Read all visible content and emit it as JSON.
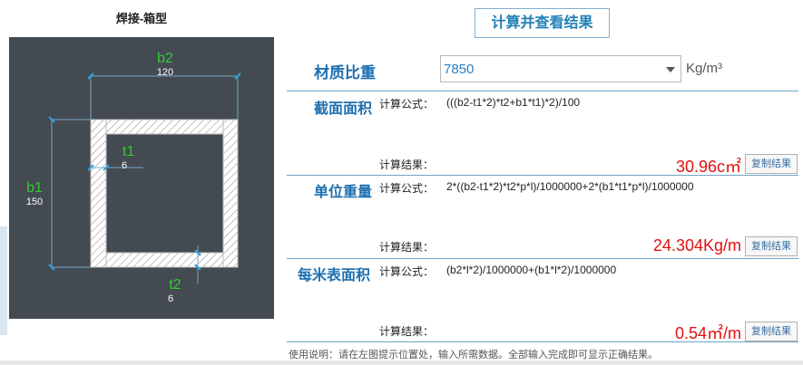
{
  "diagram": {
    "title": "焊接-箱型",
    "b2": {
      "label": "b2",
      "value": "120"
    },
    "b1": {
      "label": "b1",
      "value": "150"
    },
    "t1": {
      "label": "t1",
      "value": "6"
    },
    "t2": {
      "label": "t2",
      "value": "6"
    }
  },
  "calc_button": "计算并查看结果",
  "density": {
    "label": "材质比重",
    "value": "7850",
    "unit": "Kg/m³"
  },
  "sections": [
    {
      "title": "截面面积",
      "formula_label": "计算公式：",
      "formula": "(((b2-t1*2)*t2+b1*t1)*2)/100",
      "result_label": "计算结果：",
      "result": "30.96c㎡",
      "copy": "复制结果"
    },
    {
      "title": "单位重量",
      "formula_label": "计算公式：",
      "formula": "2*((b2-t1*2)*t2*p*l)/1000000+2*(b1*t1*p*l)/1000000",
      "result_label": "计算结果：",
      "result": "24.304Kg/m",
      "copy": "复制结果"
    },
    {
      "title": "每米表面积",
      "formula_label": "计算公式：",
      "formula": "(b2*l*2)/1000000+(b1*l*2)/1000000",
      "result_label": "计算结果：",
      "result": "0.54㎡/m",
      "copy": "复制结果"
    }
  ],
  "usage": "使用说明：请在左图提示位置处，输入所需数据。全部输入完成即可显示正确结果。",
  "colors": {
    "accent": "#1d6fb0",
    "result": "#e01010",
    "diagram_bg": "#434a51",
    "label_green": "#33cc33"
  }
}
